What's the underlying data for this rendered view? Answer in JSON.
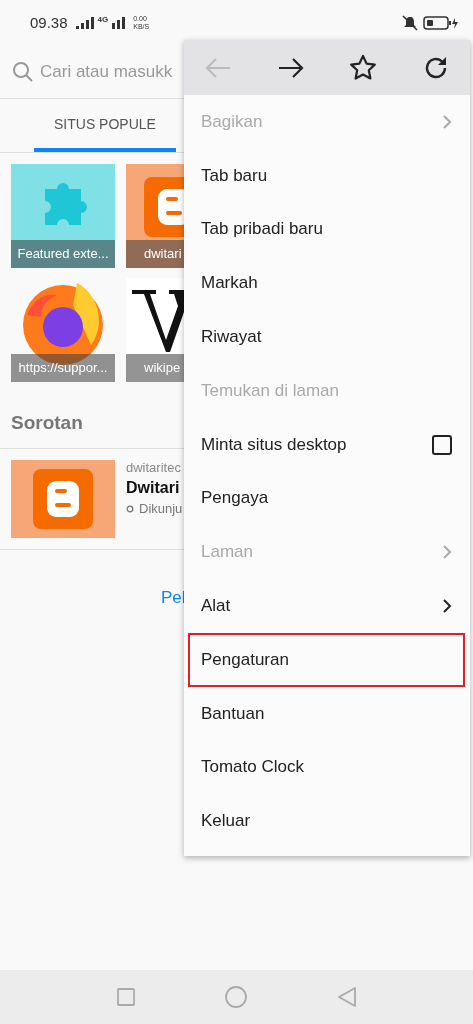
{
  "status_bar": {
    "time": "09.38",
    "network": "4G",
    "speed": "0.00",
    "speed_unit": "KB/S"
  },
  "url_bar": {
    "placeholder": "Cari atau masukk"
  },
  "tabs": [
    {
      "label": "SITUS POPULE",
      "selected": true
    }
  ],
  "top_sites": [
    {
      "label": "Featured exte...",
      "kind": "puzzle"
    },
    {
      "label": "dwitari",
      "kind": "blogger"
    },
    {
      "label": "https://suppor...",
      "kind": "firefox"
    },
    {
      "label": "wikipe",
      "kind": "wiki"
    }
  ],
  "highlights": {
    "title": "Sorotan",
    "items": [
      {
        "site": "dwitaritec",
        "title": "Dwitari",
        "meta": "Dikunju"
      }
    ]
  },
  "more_link": "Pel",
  "menu": {
    "toolbar": [
      {
        "kind": "back",
        "disabled": true
      },
      {
        "kind": "forward",
        "disabled": false
      },
      {
        "kind": "star",
        "disabled": false
      },
      {
        "kind": "reload",
        "disabled": false
      }
    ],
    "items": [
      {
        "label": "Bagikan",
        "kind": "submenu",
        "disabled": true,
        "highlighted": false
      },
      {
        "label": "Tab baru",
        "kind": "plain",
        "disabled": false,
        "highlighted": false
      },
      {
        "label": "Tab pribadi baru",
        "kind": "plain",
        "disabled": false,
        "highlighted": false
      },
      {
        "label": "Markah",
        "kind": "plain",
        "disabled": false,
        "highlighted": false
      },
      {
        "label": "Riwayat",
        "kind": "plain",
        "disabled": false,
        "highlighted": false
      },
      {
        "label": "Temukan di laman",
        "kind": "plain",
        "disabled": true,
        "highlighted": false
      },
      {
        "label": "Minta situs desktop",
        "kind": "checkbox",
        "checked": false,
        "disabled": false,
        "highlighted": false
      },
      {
        "label": "Pengaya",
        "kind": "plain",
        "disabled": false,
        "highlighted": false
      },
      {
        "label": "Laman",
        "kind": "submenu",
        "disabled": true,
        "highlighted": false
      },
      {
        "label": "Alat",
        "kind": "submenu",
        "disabled": false,
        "highlighted": false
      },
      {
        "label": "Pengaturan",
        "kind": "plain",
        "disabled": false,
        "highlighted": true
      },
      {
        "label": "Bantuan",
        "kind": "plain",
        "disabled": false,
        "highlighted": false
      },
      {
        "label": "Tomato Clock",
        "kind": "plain",
        "disabled": false,
        "highlighted": false
      },
      {
        "label": "Keluar",
        "kind": "plain",
        "disabled": false,
        "highlighted": false
      }
    ]
  }
}
